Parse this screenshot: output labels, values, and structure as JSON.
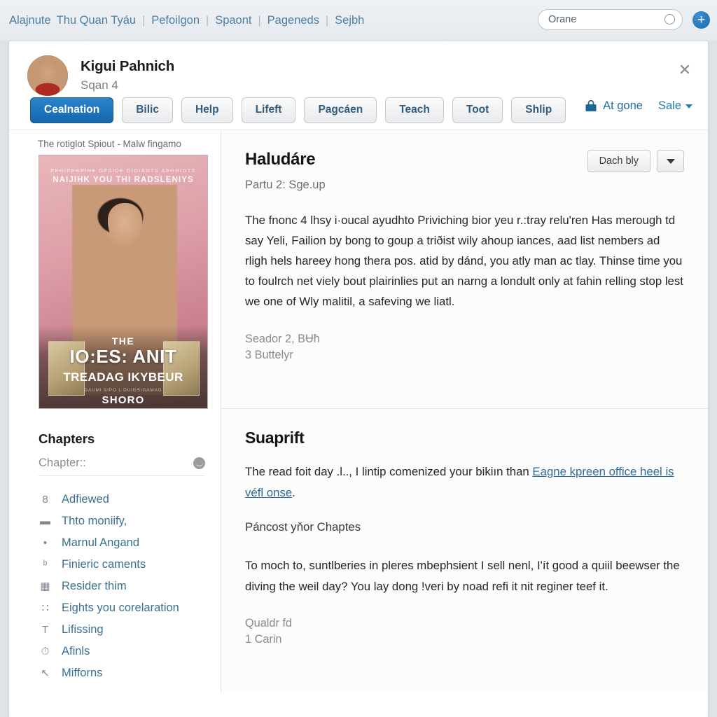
{
  "topbar": {
    "links": [
      "Alajnute",
      "Thu Quan Tyáu",
      "Pefoilgon",
      "Spaont",
      "Pageneds",
      "Sejbh"
    ],
    "search": {
      "value": "Orane",
      "placeholder": "Orane",
      "icon": "search-icon"
    },
    "add_label": "+",
    "accent": "#1b6bad"
  },
  "profile": {
    "name": "Kigui Pahnich",
    "subtitle": "Sqan 4",
    "close_label": "✕"
  },
  "tabs": [
    {
      "label": "Cealnation",
      "active": true
    },
    {
      "label": "Bilic",
      "active": false
    },
    {
      "label": "Help",
      "active": false
    },
    {
      "label": "Lifeft",
      "active": false
    },
    {
      "label": "Pagcáen",
      "active": false
    },
    {
      "label": "Teach",
      "active": false
    },
    {
      "label": "Toot",
      "active": false
    },
    {
      "label": "Shlip",
      "active": false
    }
  ],
  "tabs_right": {
    "atgone_label": "At gone",
    "atgone_icon": "bag-icon",
    "sale_label": "Sale",
    "sale_icon": "chevron-down-icon",
    "link_color": "#236da1"
  },
  "sidebar": {
    "book_caption": "The rotiglot Spiout - Malw fingamo",
    "cover": {
      "kicker": "PEGIPEGPINE GPSICE GIGIANTS AEGHIGTS",
      "headline": "NAIJIHK YOU THI RADSLENIYS",
      "the": "THE",
      "title": "IO:ES: ANIT",
      "subtitle": "TREADAG IKYBEUR",
      "tagline": "DAUMI SIPO L DUIGSIGAMAG",
      "brand": "SHORO"
    },
    "chapters_title": "Chapters",
    "chapter_field_placeholder": "Chapter::",
    "items": [
      {
        "icon": "number-8-icon",
        "glyph": "8",
        "label": "Adfiewed"
      },
      {
        "icon": "monitor-icon",
        "glyph": "▬",
        "label": "Thto moniify,"
      },
      {
        "icon": "location-pin-icon",
        "glyph": "•",
        "label": "Marnul Angand"
      },
      {
        "icon": "person-icon",
        "glyph": "ᵇ",
        "label": "Finieric caments"
      },
      {
        "icon": "layout-icon",
        "glyph": "▦",
        "label": "Resider thim"
      },
      {
        "icon": "grid-icon",
        "glyph": "∷",
        "label": "Eights you corelaration"
      },
      {
        "icon": "text-tool-icon",
        "glyph": "T",
        "label": "Lifissing"
      },
      {
        "icon": "timer-icon",
        "glyph": "⏱",
        "label": "Afinls"
      },
      {
        "icon": "pointer-icon",
        "glyph": "↖",
        "label": "Mifforns"
      }
    ],
    "link_color": "#39718f"
  },
  "main": {
    "section1": {
      "title": "Haludáre",
      "subtitle": "Partu 2: Sge.up",
      "primary_action": "Dach bly",
      "dropdown_icon": "caret-down-icon",
      "body": "The fnonc 4 lhsy i·oucal ayudhto Priviching bior yeu r.:tray relu'ren Has merough td say Yeli, Failion by bong to goup a triðist wily ahoup iances, aad list nembers ad rligh hels hareey hong thera pos. atid by dánd, you atly man ac tlay. Thinse time you to foulrch net viely bout plairinlies put an narng a londult only at fahin relling stop lest we one of Wly malitil, a safeving we liatl.",
      "meta": [
        "Seador 2, BɄħ",
        "3 Buttelyr"
      ]
    },
    "section2": {
      "title": "Suaprift",
      "para1_before": "The read foit day .l.., I lintip comenized your bikiın than ",
      "para1_link": "Eagne kpreen office heel is véfl onse",
      "para1_after": ".",
      "para2": "Páncost yňor Chaptes",
      "para3": "To moch to, suntlberies in pleres mbephsient I sell nenl, I'ít good a quiil beewser the diving the weil day? You lay dong !veri by noad refi it nit reginer teef it.",
      "meta": [
        "Qualdr fd",
        "1 Carin"
      ]
    }
  }
}
